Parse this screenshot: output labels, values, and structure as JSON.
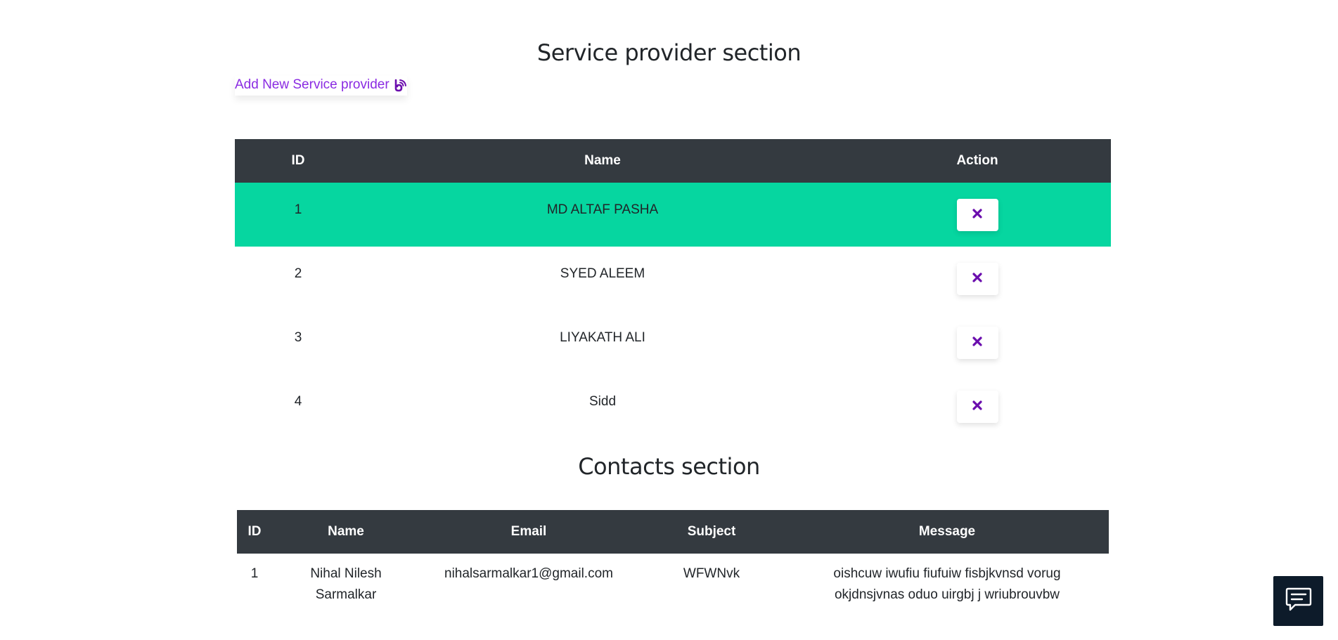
{
  "service_provider": {
    "title": "Service provider section",
    "add_link_label": "Add New Service provider",
    "add_link_icon": "bell-ring-icon",
    "columns": [
      "ID",
      "Name",
      "Action"
    ],
    "rows": [
      {
        "id": "1",
        "name": "MD ALTAF PASHA",
        "highlighted": true
      },
      {
        "id": "2",
        "name": "SYED ALEEM",
        "highlighted": false
      },
      {
        "id": "3",
        "name": "LIYAKATH ALI",
        "highlighted": false
      },
      {
        "id": "4",
        "name": "Sidd",
        "highlighted": false
      }
    ],
    "delete_icon": "close-icon"
  },
  "contacts": {
    "title": "Contacts section",
    "columns": [
      "ID",
      "Name",
      "Email",
      "Subject",
      "Message"
    ],
    "rows": [
      {
        "id": "1",
        "name": "Nihal Nilesh Sarmalkar",
        "email": "nihalsarmalkar1@gmail.com",
        "subject": "WFWNvk",
        "message": "oishcuw iwufiu fiufuiw fisbjkvnsd vorug okjdnsjvnas oduo uirgbj j wriubrouvbw"
      }
    ]
  },
  "chat_widget": {
    "icon": "chat-icon"
  },
  "colors": {
    "accent": "#8a2be2",
    "icon_purple": "#6a0dad",
    "header_bg": "#343a40",
    "highlight_row": "#06d6a0",
    "chat_bg": "#0d1b2a"
  }
}
